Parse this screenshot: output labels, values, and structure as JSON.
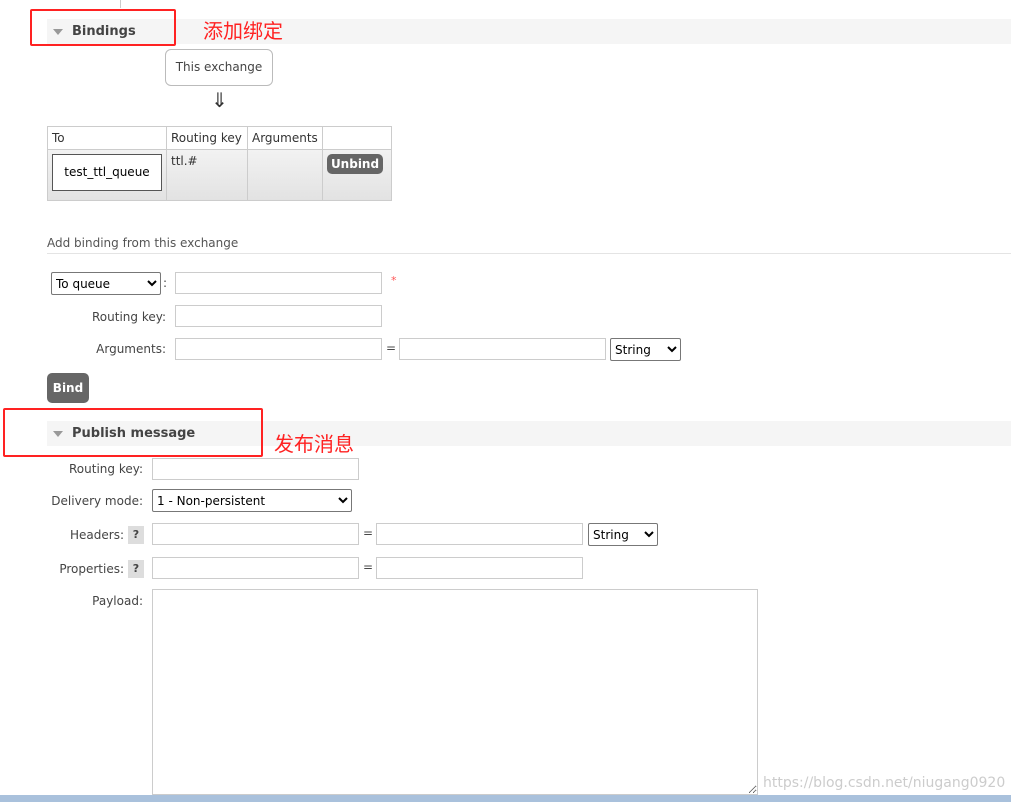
{
  "bindings": {
    "title": "Bindings",
    "annotation": "添加绑定",
    "source": "This exchange",
    "arrow": "⇓",
    "columns": [
      "To",
      "Routing key",
      "Arguments",
      ""
    ],
    "rows": [
      {
        "to": "test_ttl_queue",
        "routing_key": "ttl.#",
        "arguments": "",
        "action": "Unbind"
      }
    ]
  },
  "add_binding": {
    "title": "Add binding from this exchange",
    "destination_type": "To queue",
    "destination_value": "",
    "required_mark": "*",
    "routing_key_label": "Routing key:",
    "routing_key_value": "",
    "arguments_label": "Arguments:",
    "arg_key": "",
    "eq": "=",
    "arg_value": "",
    "arg_type": "String",
    "bind_label": "Bind",
    "colon": ":"
  },
  "publish": {
    "title": "Publish message",
    "annotation": "发布消息",
    "routing_key_label": "Routing key:",
    "routing_key_value": "",
    "delivery_mode_label": "Delivery mode:",
    "delivery_mode": "1 - Non-persistent",
    "headers_label": "Headers:",
    "help": "?",
    "eq": "=",
    "header_type": "String",
    "properties_label": "Properties:",
    "payload_label": "Payload:",
    "payload": ""
  },
  "watermark": "https://blog.csdn.net/niugang0920"
}
